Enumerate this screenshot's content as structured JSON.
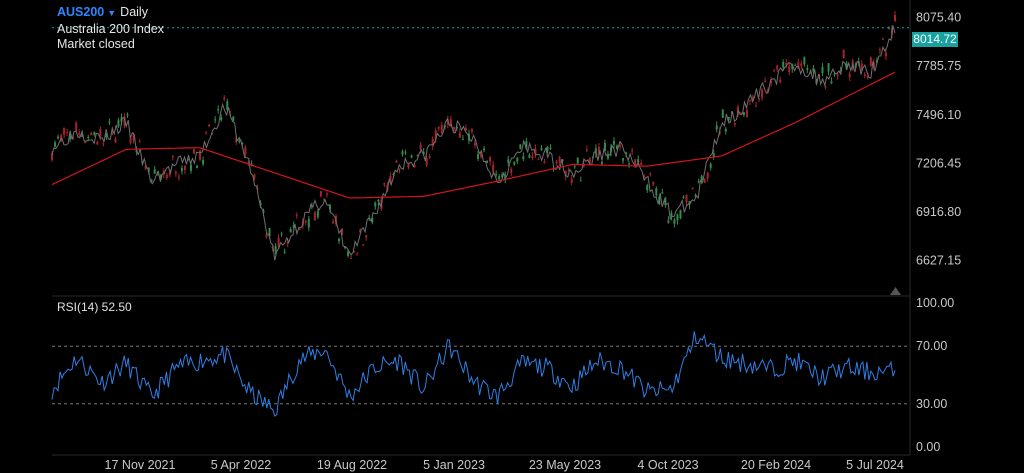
{
  "header": {
    "symbol": "AUS200",
    "interval": "Daily",
    "name": "Australia 200 Index",
    "status": "Market closed"
  },
  "last_price": "8014.72",
  "colors": {
    "background": "#000000",
    "price_line": "#6f6f6f",
    "moving_average": "#d0161d",
    "rsi_line": "#2f7fe5",
    "last_price_tag": "#17a2a0",
    "accent": "#2e86ff",
    "up_candle": "#2f8f4a",
    "down_candle": "#a8232c"
  },
  "price_axis": {
    "ticks": [
      "8075.40",
      "7785.75",
      "7496.10",
      "7206.45",
      "6916.80",
      "6627.15"
    ]
  },
  "rsi": {
    "label": "RSI(14) 52.50",
    "ticks": [
      "100.00",
      "70.00",
      "30.00",
      "0.00"
    ]
  },
  "x_axis": {
    "labels": [
      "17 Nov 2021",
      "5 Apr 2022",
      "19 Aug 2022",
      "5 Jan 2023",
      "23 May 2023",
      "4 Oct 2023",
      "20 Feb 2024",
      "5 Jul 2024"
    ]
  },
  "icons": {
    "interval_toggle": "caret-down-icon",
    "scroll_marker": "triangle-up-icon"
  },
  "chart_data": [
    {
      "type": "line",
      "title": "Australia 200 Index",
      "xlabel": "",
      "ylabel": "",
      "ylim": [
        6440,
        8180
      ],
      "grid": false,
      "legend": "none",
      "series": [
        {
          "name": "",
          "x": [
            "2021-09-01",
            "2021-10-01",
            "2021-11-01",
            "2021-12-01",
            "2022-01-01",
            "2022-02-01",
            "2022-03-01",
            "2022-04-01",
            "2022-05-01",
            "2022-06-01",
            "2022-07-01",
            "2022-08-01",
            "2022-09-01",
            "2022-10-01",
            "2022-11-01",
            "2022-12-01",
            "2023-01-01",
            "2023-02-01",
            "2023-03-01",
            "2023-04-01",
            "2023-05-01",
            "2023-06-01",
            "2023-07-01",
            "2023-08-01",
            "2023-09-01",
            "2023-10-01",
            "2023-11-01",
            "2023-12-01",
            "2024-01-01",
            "2024-02-01",
            "2024-03-01",
            "2024-04-01",
            "2024-05-01",
            "2024-06-01",
            "2024-07-01"
          ],
          "values": [
            7300,
            7400,
            7350,
            7450,
            7100,
            7200,
            7250,
            7550,
            7200,
            6650,
            6850,
            7000,
            6650,
            6900,
            7200,
            7250,
            7450,
            7350,
            7100,
            7300,
            7250,
            7150,
            7250,
            7300,
            7100,
            6900,
            7000,
            7450,
            7550,
            7700,
            7800,
            7700,
            7800,
            7750,
            8014
          ]
        },
        {
          "name": "",
          "x": [
            "2021-09-01",
            "2021-12-01",
            "2022-03-01",
            "2022-06-01",
            "2022-09-01",
            "2022-12-01",
            "2023-03-01",
            "2023-06-01",
            "2023-09-01",
            "2023-12-01",
            "2024-03-01",
            "2024-07-01"
          ],
          "values": [
            7080,
            7290,
            7300,
            7150,
            7000,
            7010,
            7100,
            7200,
            7190,
            7250,
            7450,
            7750
          ]
        }
      ]
    },
    {
      "type": "line",
      "title": "RSI(14)",
      "ylim": [
        0,
        100
      ],
      "reference_lines": [
        70,
        30
      ],
      "series": [
        {
          "name": "",
          "x": [
            "2021-09-01",
            "2021-10-01",
            "2021-11-01",
            "2021-12-01",
            "2022-01-01",
            "2022-02-01",
            "2022-03-01",
            "2022-04-01",
            "2022-05-01",
            "2022-06-01",
            "2022-07-01",
            "2022-08-01",
            "2022-09-01",
            "2022-10-01",
            "2022-11-01",
            "2022-12-01",
            "2023-01-01",
            "2023-02-01",
            "2023-03-01",
            "2023-04-01",
            "2023-05-01",
            "2023-06-01",
            "2023-07-01",
            "2023-08-01",
            "2023-09-01",
            "2023-10-01",
            "2023-11-01",
            "2023-12-01",
            "2024-01-01",
            "2024-02-01",
            "2024-03-01",
            "2024-04-01",
            "2024-05-01",
            "2024-06-01",
            "2024-07-01"
          ],
          "values": [
            40,
            62,
            45,
            58,
            35,
            55,
            60,
            64,
            38,
            25,
            60,
            68,
            35,
            55,
            60,
            40,
            70,
            45,
            35,
            58,
            55,
            42,
            60,
            55,
            38,
            40,
            78,
            62,
            58,
            54,
            60,
            48,
            55,
            52,
            52.5
          ]
        }
      ]
    }
  ]
}
